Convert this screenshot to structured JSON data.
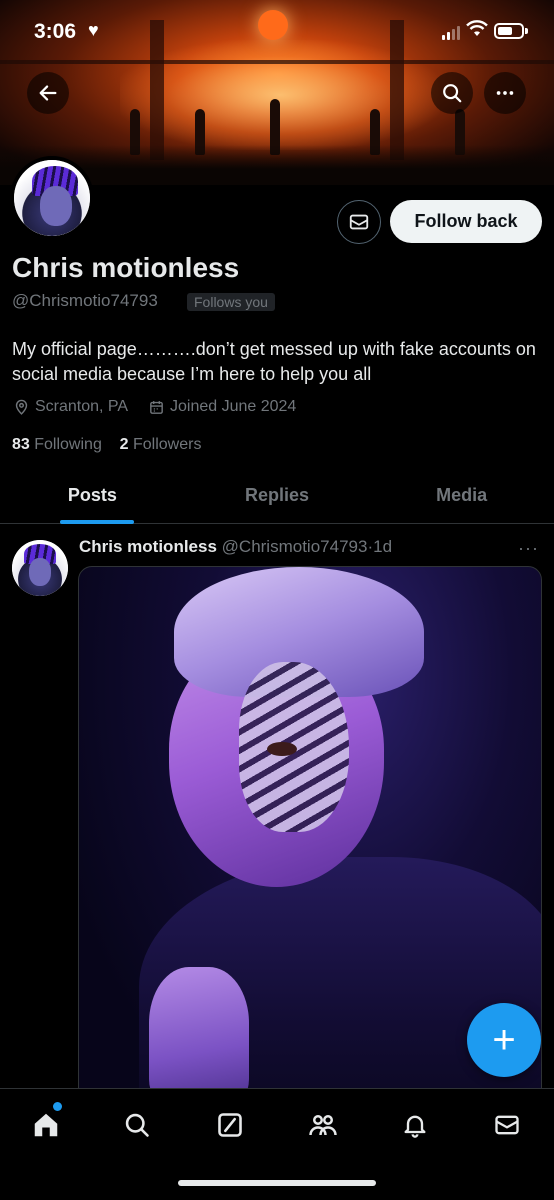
{
  "status_bar": {
    "time": "3:06"
  },
  "profile": {
    "name": "Chris motionless",
    "handle": "@Chrismotio74793",
    "follows_you": "Follows you",
    "bio": "My official page……….don’t get messed up with fake accounts on social media because I’m here to help you all",
    "location": "Scranton, PA",
    "joined": "Joined June 2024",
    "following_count": "83",
    "following_label": "Following",
    "followers_count": "2",
    "followers_label": "Followers",
    "follow_button": "Follow back"
  },
  "tabs": [
    {
      "label": "Posts",
      "active": true
    },
    {
      "label": "Replies",
      "active": false
    },
    {
      "label": "Media",
      "active": false
    }
  ],
  "post": {
    "name": "Chris motionless",
    "handle": "@Chrismotio74793",
    "time": "1d",
    "more": "···"
  },
  "fab": {
    "label": "+"
  },
  "colors": {
    "accent": "#1d9bf0",
    "background": "#000000",
    "text_primary": "#e7e9ea",
    "text_secondary": "#71767b"
  },
  "icons": {
    "back": "arrow-left-icon",
    "search": "search-icon",
    "more": "more-icon",
    "message": "envelope-icon",
    "location": "location-pin-icon",
    "calendar": "calendar-icon",
    "nav": [
      "home-icon",
      "search-icon",
      "grok-icon",
      "communities-icon",
      "bell-icon",
      "envelope-icon"
    ]
  }
}
